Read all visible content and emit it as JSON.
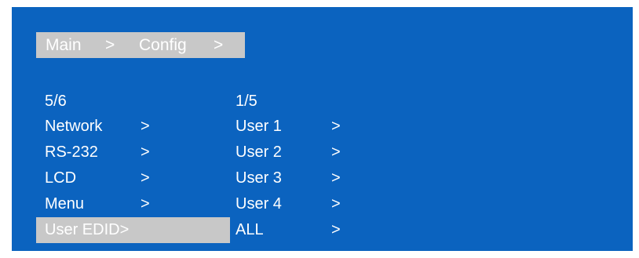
{
  "breadcrumb": {
    "part1": "Main",
    "sep1": ">",
    "part2": "Config",
    "sep2": ">"
  },
  "left_menu": {
    "pager": "5/6",
    "items": [
      {
        "label": "Network",
        "arrow": ">"
      },
      {
        "label": "RS-232",
        "arrow": ">"
      },
      {
        "label": "LCD",
        "arrow": ">"
      },
      {
        "label": "Menu",
        "arrow": ">"
      },
      {
        "label": "User EDID>",
        "arrow": ""
      }
    ],
    "selected_index": 4
  },
  "right_menu": {
    "pager": "1/5",
    "items": [
      {
        "label": "User 1",
        "arrow": ">"
      },
      {
        "label": "User 2",
        "arrow": ">"
      },
      {
        "label": "User 3",
        "arrow": ">"
      },
      {
        "label": "User 4",
        "arrow": ">"
      },
      {
        "label": "ALL",
        "arrow": ">"
      }
    ]
  },
  "colors": {
    "background": "#0b63bf",
    "highlight": "#c8c8c8",
    "text": "#ffffff"
  }
}
